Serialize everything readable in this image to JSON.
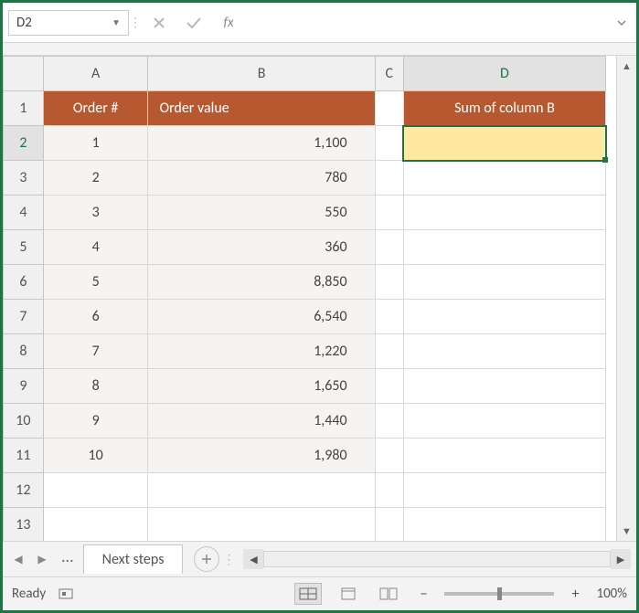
{
  "formula_bar": {
    "name_box": "D2",
    "fx_label": "fx",
    "formula_value": ""
  },
  "columns": {
    "A": "A",
    "B": "B",
    "C": "C",
    "D": "D"
  },
  "row_headers": [
    "1",
    "2",
    "3",
    "4",
    "5",
    "6",
    "7",
    "8",
    "9",
    "10",
    "11",
    "12",
    "13"
  ],
  "headers": {
    "A1": "Order #",
    "B1": "Order value",
    "D1": "Sum of column B"
  },
  "data": {
    "rows": [
      {
        "order": "1",
        "value": "1,100"
      },
      {
        "order": "2",
        "value": "780"
      },
      {
        "order": "3",
        "value": "550"
      },
      {
        "order": "4",
        "value": "360"
      },
      {
        "order": "5",
        "value": "8,850"
      },
      {
        "order": "6",
        "value": "6,540"
      },
      {
        "order": "7",
        "value": "1,220"
      },
      {
        "order": "8",
        "value": "1,650"
      },
      {
        "order": "9",
        "value": "1,440"
      },
      {
        "order": "10",
        "value": "1,980"
      }
    ],
    "D2": ""
  },
  "sheet_tabs": {
    "ellipsis": "...",
    "active": "Next steps"
  },
  "status": {
    "ready": "Ready",
    "zoom": "100%"
  }
}
